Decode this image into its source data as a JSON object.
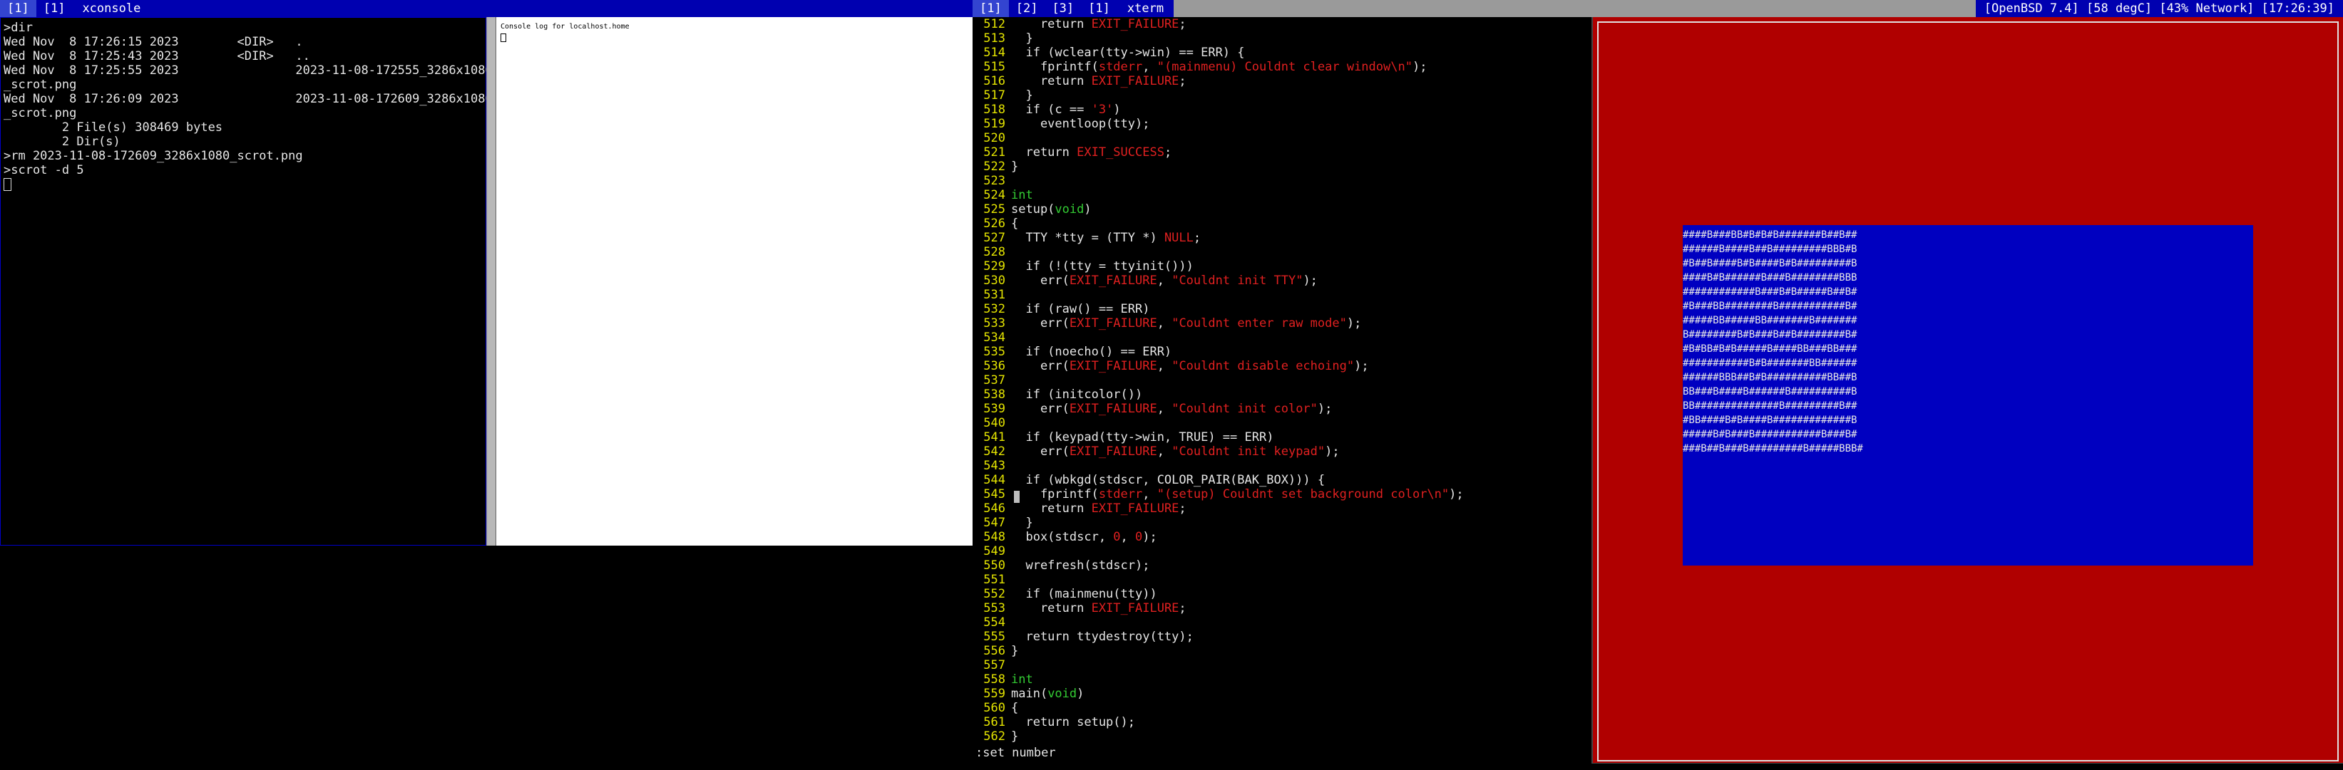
{
  "topbar_left": {
    "tags": [
      "[1]",
      "[1]"
    ],
    "active_index": 0,
    "title": "xconsole"
  },
  "topbar_right": {
    "tags": [
      "[1]",
      "[2]",
      "[3]",
      "[1]"
    ],
    "active_index": 0,
    "title": "xterm",
    "status": "[OpenBSD 7.4] [58 degC] [43% Network] [17:26:39]"
  },
  "left_terminal": {
    "lines": [
      ">dir",
      "Wed Nov  8 17:26:15 2023        <DIR>   .",
      "Wed Nov  8 17:25:43 2023        <DIR>   ..",
      "Wed Nov  8 17:25:55 2023                2023-11-08-172555_3286x1080",
      "_scrot.png",
      "Wed Nov  8 17:26:09 2023                2023-11-08-172609_3286x1080",
      "_scrot.png",
      "        2 File(s) 308469 bytes",
      "        2 Dir(s)",
      ">rm 2023-11-08-172609_3286x1080_scrot.png",
      ">scrot -d 5"
    ]
  },
  "xconsole": {
    "title": "Console log for localhost.home"
  },
  "editor": {
    "lines": [
      {
        "n": "512",
        "parts": [
          [
            "    return ",
            ""
          ],
          [
            "EXIT_FAILURE",
            "red"
          ],
          [
            ";",
            ""
          ]
        ]
      },
      {
        "n": "513",
        "parts": [
          [
            "  }",
            ""
          ]
        ]
      },
      {
        "n": "514",
        "parts": [
          [
            "  if (wclear(tty->win) == ERR) {",
            ""
          ]
        ]
      },
      {
        "n": "515",
        "parts": [
          [
            "    fprintf(",
            ""
          ],
          [
            "stderr",
            "red"
          ],
          [
            ", ",
            ""
          ],
          [
            "\"(mainmenu) Couldnt clear window\\n\"",
            "red"
          ],
          [
            ");",
            ""
          ]
        ]
      },
      {
        "n": "516",
        "parts": [
          [
            "    return ",
            ""
          ],
          [
            "EXIT_FAILURE",
            "red"
          ],
          [
            ";",
            ""
          ]
        ]
      },
      {
        "n": "517",
        "parts": [
          [
            "  }",
            ""
          ]
        ]
      },
      {
        "n": "518",
        "parts": [
          [
            "  if (c == ",
            ""
          ],
          [
            "'3'",
            "red"
          ],
          [
            ")",
            ""
          ]
        ]
      },
      {
        "n": "519",
        "parts": [
          [
            "    eventloop(tty);",
            ""
          ]
        ]
      },
      {
        "n": "520",
        "parts": [
          [
            "",
            ""
          ]
        ]
      },
      {
        "n": "521",
        "parts": [
          [
            "  return ",
            ""
          ],
          [
            "EXIT_SUCCESS",
            "red"
          ],
          [
            ";",
            ""
          ]
        ]
      },
      {
        "n": "522",
        "parts": [
          [
            "}",
            ""
          ]
        ]
      },
      {
        "n": "523",
        "parts": [
          [
            "",
            ""
          ]
        ]
      },
      {
        "n": "524",
        "parts": [
          [
            "int",
            "grn"
          ]
        ]
      },
      {
        "n": "525",
        "parts": [
          [
            "setup(",
            ""
          ],
          [
            "void",
            "grn"
          ],
          [
            ")",
            ""
          ]
        ]
      },
      {
        "n": "526",
        "parts": [
          [
            "{",
            ""
          ]
        ]
      },
      {
        "n": "527",
        "parts": [
          [
            "  TTY *tty = (TTY *) ",
            ""
          ],
          [
            "NULL",
            "red"
          ],
          [
            ";",
            ""
          ]
        ]
      },
      {
        "n": "528",
        "parts": [
          [
            "",
            ""
          ]
        ]
      },
      {
        "n": "529",
        "parts": [
          [
            "  if (!(tty = ttyinit()))",
            ""
          ]
        ]
      },
      {
        "n": "530",
        "parts": [
          [
            "    err(",
            ""
          ],
          [
            "EXIT_FAILURE",
            "red"
          ],
          [
            ", ",
            ""
          ],
          [
            "\"Couldnt init TTY\"",
            "red"
          ],
          [
            ");",
            ""
          ]
        ]
      },
      {
        "n": "531",
        "parts": [
          [
            "",
            ""
          ]
        ]
      },
      {
        "n": "532",
        "parts": [
          [
            "  if (raw() == ERR)",
            ""
          ]
        ]
      },
      {
        "n": "533",
        "parts": [
          [
            "    err(",
            ""
          ],
          [
            "EXIT_FAILURE",
            "red"
          ],
          [
            ", ",
            ""
          ],
          [
            "\"Couldnt enter raw mode\"",
            "red"
          ],
          [
            ");",
            ""
          ]
        ]
      },
      {
        "n": "534",
        "parts": [
          [
            "",
            ""
          ]
        ]
      },
      {
        "n": "535",
        "parts": [
          [
            "  if (noecho() == ERR)",
            ""
          ]
        ]
      },
      {
        "n": "536",
        "parts": [
          [
            "    err(",
            ""
          ],
          [
            "EXIT_FAILURE",
            "red"
          ],
          [
            ", ",
            ""
          ],
          [
            "\"Couldnt disable echoing\"",
            "red"
          ],
          [
            ");",
            ""
          ]
        ]
      },
      {
        "n": "537",
        "parts": [
          [
            "",
            ""
          ]
        ]
      },
      {
        "n": "538",
        "parts": [
          [
            "  if (initcolor())",
            ""
          ]
        ]
      },
      {
        "n": "539",
        "parts": [
          [
            "    err(",
            ""
          ],
          [
            "EXIT_FAILURE",
            "red"
          ],
          [
            ", ",
            ""
          ],
          [
            "\"Couldnt init color\"",
            "red"
          ],
          [
            ");",
            ""
          ]
        ]
      },
      {
        "n": "540",
        "parts": [
          [
            "",
            ""
          ]
        ]
      },
      {
        "n": "541",
        "parts": [
          [
            "  if (keypad(tty->win, TRUE) == ERR)",
            ""
          ]
        ]
      },
      {
        "n": "542",
        "parts": [
          [
            "    err(",
            ""
          ],
          [
            "EXIT_FAILURE",
            "red"
          ],
          [
            ", ",
            ""
          ],
          [
            "\"Couldnt init keypad\"",
            "red"
          ],
          [
            ");",
            ""
          ]
        ]
      },
      {
        "n": "543",
        "parts": [
          [
            "",
            ""
          ]
        ]
      },
      {
        "n": "544",
        "parts": [
          [
            "  if (wbkgd(stdscr, COLOR_PAIR(BAK_BOX))) {",
            ""
          ]
        ]
      },
      {
        "n": "545",
        "parts": [
          [
            "    fprintf(",
            ""
          ],
          [
            "stderr",
            "red"
          ],
          [
            ", ",
            ""
          ],
          [
            "\"(setup) Couldnt set background color\\n\"",
            "red"
          ],
          [
            ");",
            ""
          ]
        ]
      },
      {
        "n": "546",
        "parts": [
          [
            "    return ",
            ""
          ],
          [
            "EXIT_FAILURE",
            "red"
          ],
          [
            ";",
            ""
          ]
        ]
      },
      {
        "n": "547",
        "parts": [
          [
            "  }",
            ""
          ]
        ]
      },
      {
        "n": "548",
        "parts": [
          [
            "  box(stdscr, ",
            ""
          ],
          [
            "0",
            "red"
          ],
          [
            ", ",
            ""
          ],
          [
            "0",
            "red"
          ],
          [
            ");",
            ""
          ]
        ]
      },
      {
        "n": "549",
        "parts": [
          [
            "",
            ""
          ]
        ]
      },
      {
        "n": "550",
        "parts": [
          [
            "  wrefresh(stdscr);",
            ""
          ]
        ]
      },
      {
        "n": "551",
        "parts": [
          [
            "",
            ""
          ]
        ]
      },
      {
        "n": "552",
        "parts": [
          [
            "  if (mainmenu(tty))",
            ""
          ]
        ]
      },
      {
        "n": "553",
        "parts": [
          [
            "    return ",
            ""
          ],
          [
            "EXIT_FAILURE",
            "red"
          ],
          [
            ";",
            ""
          ]
        ]
      },
      {
        "n": "554",
        "parts": [
          [
            "",
            ""
          ]
        ]
      },
      {
        "n": "555",
        "parts": [
          [
            "  return ttydestroy(tty);",
            ""
          ]
        ]
      },
      {
        "n": "556",
        "parts": [
          [
            "}",
            ""
          ]
        ]
      },
      {
        "n": "557",
        "parts": [
          [
            "",
            ""
          ]
        ]
      },
      {
        "n": "558",
        "parts": [
          [
            "int",
            "grn"
          ]
        ]
      },
      {
        "n": "559",
        "parts": [
          [
            "main(",
            ""
          ],
          [
            "void",
            "grn"
          ],
          [
            ")",
            ""
          ]
        ]
      },
      {
        "n": "560",
        "parts": [
          [
            "{",
            ""
          ]
        ]
      },
      {
        "n": "561",
        "parts": [
          [
            "  return setup();",
            ""
          ]
        ]
      },
      {
        "n": "562",
        "parts": [
          [
            "}",
            ""
          ]
        ]
      }
    ],
    "mode_line": ":set number"
  },
  "game_grid": [
    "####B###BB#B#B#B#######B##B##",
    "######B####B##B#########BBB#B",
    "#B##B####B#B####B#B#########B",
    "####B#B######B###B########BBB",
    "############B###B#B#####B##B#",
    "#B###BB########B###########B#",
    "#####BB#####BB#######B#######",
    "B########B#B###B##B########B#",
    "#B#BB#B#B#####B####BB###BB###",
    "###########B#B#######BB######",
    "######BBB##B#B##########BB##B",
    "BB###B####B######B##########B",
    "BB##############B#########B##",
    "#BB####B#B####B#############B",
    "#####B#B###B###########B###B#",
    "###B##B###B#########B#####BBB#"
  ],
  "colors": {
    "bar_blue": "#0000b0",
    "editor_line_numbers": "#e4e400",
    "game_red": "#b00000",
    "game_blue": "#0000c0"
  }
}
